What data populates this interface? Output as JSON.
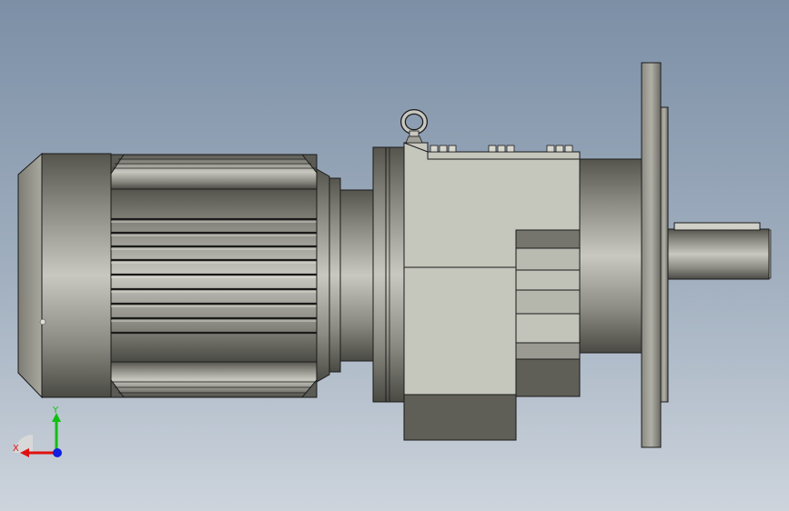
{
  "viewport": {
    "background_top": "#7c8fa6",
    "background_bottom": "#cdd4dc",
    "model_name": "gear-motor"
  },
  "triad": {
    "x_label": "X",
    "y_label": "Y",
    "x_color": "#e01010",
    "y_color": "#10c010",
    "z_color": "#1020e0"
  },
  "colors": {
    "body": "#c5c6bc",
    "dark": "#5f5f58",
    "edge": "#1a1a1a"
  }
}
